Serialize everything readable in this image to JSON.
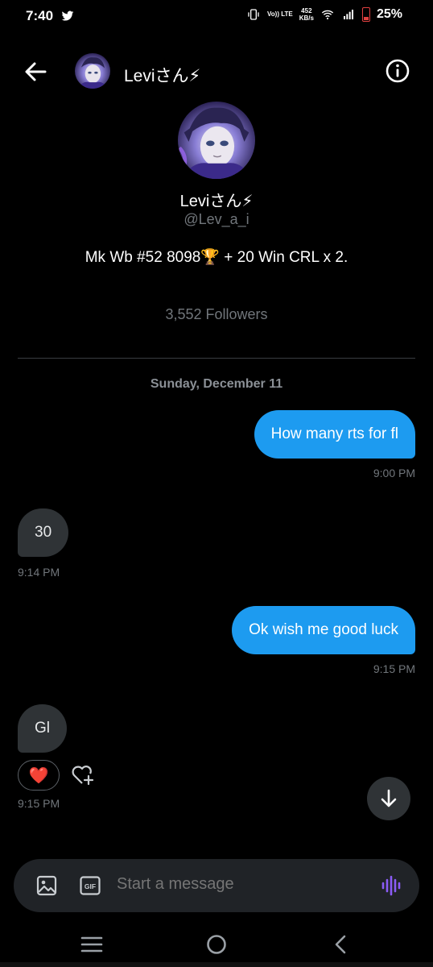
{
  "status_bar": {
    "time": "7:40",
    "volte": "Vo)) LTE",
    "speed_value": "452",
    "speed_unit": "KB/s",
    "battery": "25%",
    "icons": [
      "twitter-bird-icon",
      "vibrate-icon",
      "wifi-icon",
      "signal-icon",
      "battery-icon"
    ]
  },
  "header": {
    "name": "Leviさん⚡",
    "icons": [
      "back-arrow-icon",
      "info-icon"
    ]
  },
  "profile": {
    "name": "Leviさん⚡",
    "handle": "@Lev_a_i",
    "bio": "Mk Wb #52 8098🏆 + 20 Win CRL x 2.",
    "followers": "3,552 Followers"
  },
  "conversation": {
    "date": "Sunday, December 11",
    "messages": [
      {
        "dir": "out",
        "text": "How many rts for fl",
        "time": "9:00 PM"
      },
      {
        "dir": "in",
        "text": "30",
        "time": "9:14 PM"
      },
      {
        "dir": "out",
        "text": "Ok wish me good luck",
        "time": "9:15 PM"
      },
      {
        "dir": "in",
        "text": "Gl",
        "time": "9:15 PM",
        "reaction": "❤️"
      }
    ]
  },
  "composer": {
    "placeholder": "Start a message",
    "gif_label": "GIF",
    "icons": [
      "image-icon",
      "gif-icon",
      "voice-icon"
    ]
  },
  "colors": {
    "accent": "#1d9bf0",
    "incoming_bubble": "#2f3336",
    "background": "#000000",
    "voice": "#8b5cf6"
  }
}
